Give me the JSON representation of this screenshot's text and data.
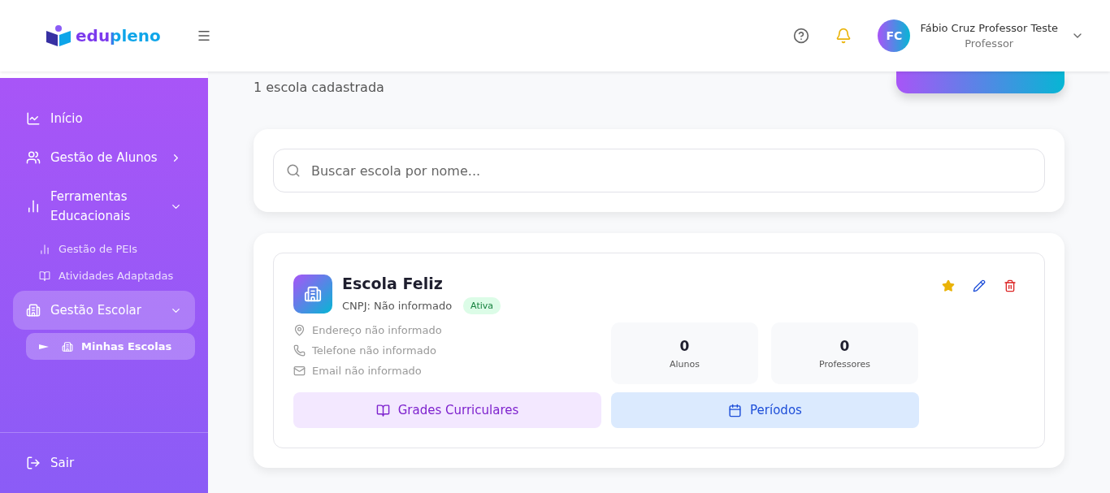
{
  "header": {
    "logo": "edupleno",
    "user": {
      "initials": "FC",
      "name": "Fábio Cruz Professor Teste",
      "role": "Professor"
    }
  },
  "sidebar": {
    "items": [
      {
        "label": "Início",
        "selected": false
      },
      {
        "label": "Gestão de Alunos",
        "selected": false,
        "expanded": false
      },
      {
        "label": "Ferramentas Educacionais",
        "selected": false,
        "expanded": true,
        "children": [
          {
            "label": "Gestão de PEIs",
            "selected": false
          },
          {
            "label": "Atividades Adaptadas",
            "selected": false
          }
        ]
      },
      {
        "label": "Gestão Escolar",
        "selected": true,
        "expanded": true,
        "children": [
          {
            "label": "Minhas Escolas",
            "selected": true
          }
        ]
      }
    ],
    "logout": "Sair"
  },
  "summary": "1 escola cadastrada",
  "search": {
    "placeholder": "Buscar escola por nome..."
  },
  "schools": [
    {
      "name": "Escola Feliz",
      "cnpj": "CNPJ: Não informado",
      "status": "Ativa",
      "favorite": true,
      "details": [
        "Endereço não informado",
        "Telefone não informado",
        "Email não informado"
      ],
      "stats": [
        {
          "value": "0",
          "label": "Alunos"
        },
        {
          "value": "0",
          "label": "Professores"
        }
      ],
      "actions": [
        {
          "label": "Grades Curriculares",
          "kind": "curriculum"
        },
        {
          "label": "Períodos",
          "kind": "periods"
        }
      ]
    }
  ]
}
